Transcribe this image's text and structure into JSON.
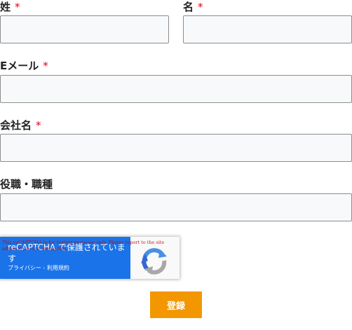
{
  "form": {
    "last_name": {
      "label": "姓",
      "required_mark": "*",
      "value": ""
    },
    "first_name": {
      "label": "名",
      "required_mark": "*",
      "value": ""
    },
    "email": {
      "label": "Eメール",
      "required_mark": "*",
      "value": ""
    },
    "company": {
      "label": "会社名",
      "required_mark": "*",
      "value": ""
    },
    "job_title": {
      "label": "役職・職種",
      "value": ""
    }
  },
  "recaptcha": {
    "warning": "This reCAPTCHA is for testing purposes only. Please report to the site admin if you are seeing this.",
    "title": "reCAPTCHA で保護されています",
    "privacy_link": "プライバシー",
    "separator": " - ",
    "terms_link": "利用規約",
    "logo_icon": "recaptcha-logo-icon"
  },
  "submit_label": "登録",
  "colors": {
    "required_mark": "#e60012",
    "input_border": "#8c8c8c",
    "input_background": "#f7f9fa",
    "recaptcha_blue": "#1a73e8",
    "submit_background": "#f39700"
  }
}
